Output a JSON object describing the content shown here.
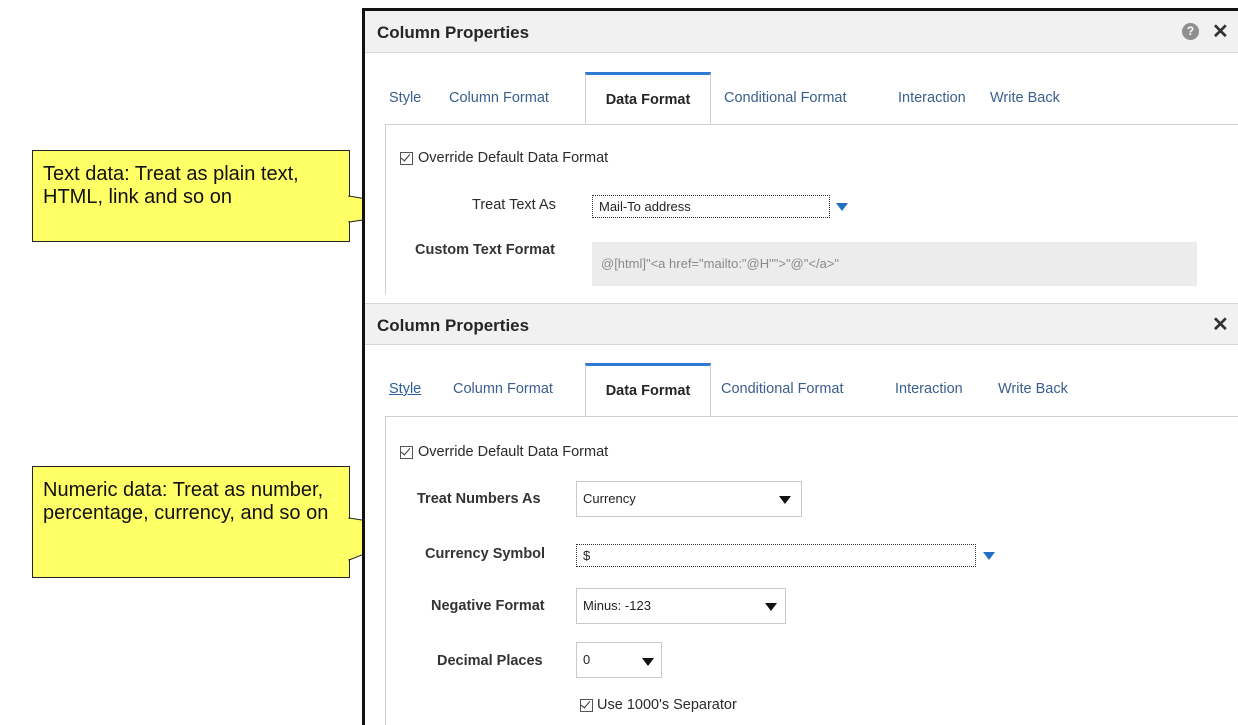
{
  "callouts": {
    "text_data": "Text data: Treat as plain text, HTML, link and so on",
    "numeric_data": "Numeric data: Treat as number, percentage, currency, and so on"
  },
  "panel1": {
    "title": "Column Properties",
    "help_icon": "help-icon",
    "close_icon": "close-icon",
    "tabs": [
      "Style",
      "Column Format",
      "Data Format",
      "Conditional Format",
      "Interaction",
      "Write Back"
    ],
    "active_tab": "Data Format",
    "override_label": "Override Default Data Format",
    "override_checked": true,
    "treat_text_as_label": "Treat Text As",
    "treat_text_as_value": "Mail-To address",
    "custom_text_format_label": "Custom Text Format",
    "custom_text_format_value": "@[html]\"<a href=\"mailto:\"@H\"\">\"@\"</a>\""
  },
  "panel2": {
    "title": "Column Properties",
    "help_icon": "help-icon",
    "close_icon": "close-icon",
    "tabs": [
      "Style",
      "Column Format",
      "Data Format",
      "Conditional Format",
      "Interaction",
      "Write Back"
    ],
    "active_tab": "Data Format",
    "override_label": "Override Default Data Format",
    "override_checked": true,
    "treat_numbers_as_label": "Treat Numbers As",
    "treat_numbers_as_value": "Currency",
    "currency_symbol_label": "Currency Symbol",
    "currency_symbol_value": "$",
    "negative_format_label": "Negative Format",
    "negative_format_value": "Minus: -123",
    "decimal_places_label": "Decimal Places",
    "decimal_places_value": "0",
    "separator_label": "Use 1000's Separator",
    "separator_checked": true
  },
  "colors": {
    "callout_fill": "#ffff66",
    "active_tab_accent": "#2f7bd3",
    "tab_link": "#3a5f8c",
    "dropdown_arrow_blue": "#1f6fc5"
  }
}
